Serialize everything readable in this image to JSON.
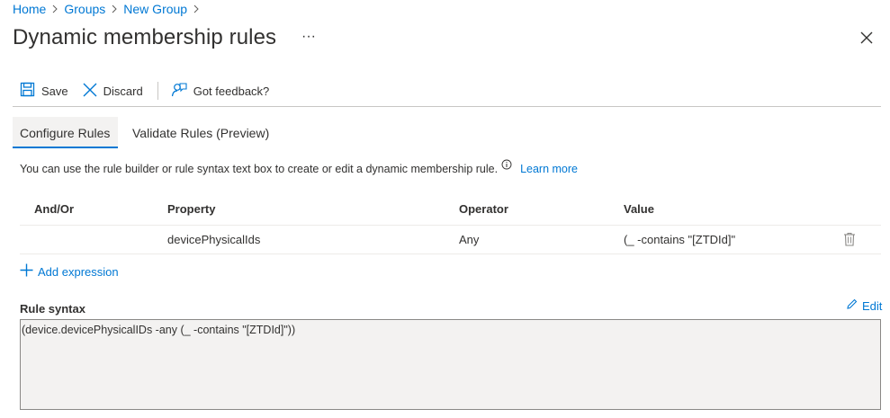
{
  "breadcrumb": {
    "items": [
      "Home",
      "Groups",
      "New Group"
    ],
    "separator": ">"
  },
  "header": {
    "title": "Dynamic membership rules",
    "more": "···"
  },
  "toolbar": {
    "save_label": "Save",
    "discard_label": "Discard",
    "feedback_label": "Got feedback?"
  },
  "tabs": [
    {
      "label": "Configure Rules",
      "selected": true
    },
    {
      "label": "Validate Rules (Preview)",
      "selected": false
    }
  ],
  "info": {
    "text": "You can use the rule builder or rule syntax text box to create or edit a dynamic membership rule.",
    "learn_more": "Learn more"
  },
  "rules_table": {
    "columns": [
      "And/Or",
      "Property",
      "Operator",
      "Value"
    ],
    "rows": [
      {
        "and_or": "",
        "property": "devicePhysicalIds",
        "operator": "Any",
        "value": "(_ -contains \"[ZTDId]\""
      }
    ]
  },
  "add_expression_label": "Add expression",
  "rule_syntax": {
    "label": "Rule syntax",
    "edit_label": "Edit",
    "value": "(device.devicePhysicalIDs -any (_ -contains \"[ZTDId]\"))"
  },
  "colors": {
    "accent": "#0078d4",
    "text": "#323130",
    "border": "#c8c6c4",
    "textbox_bg": "#f3f2f1"
  },
  "icons": [
    "chevron-right-icon",
    "more-icon",
    "close-icon",
    "save-icon",
    "discard-icon",
    "feedback-icon",
    "info-icon",
    "delete-icon",
    "add-icon",
    "edit-icon"
  ]
}
